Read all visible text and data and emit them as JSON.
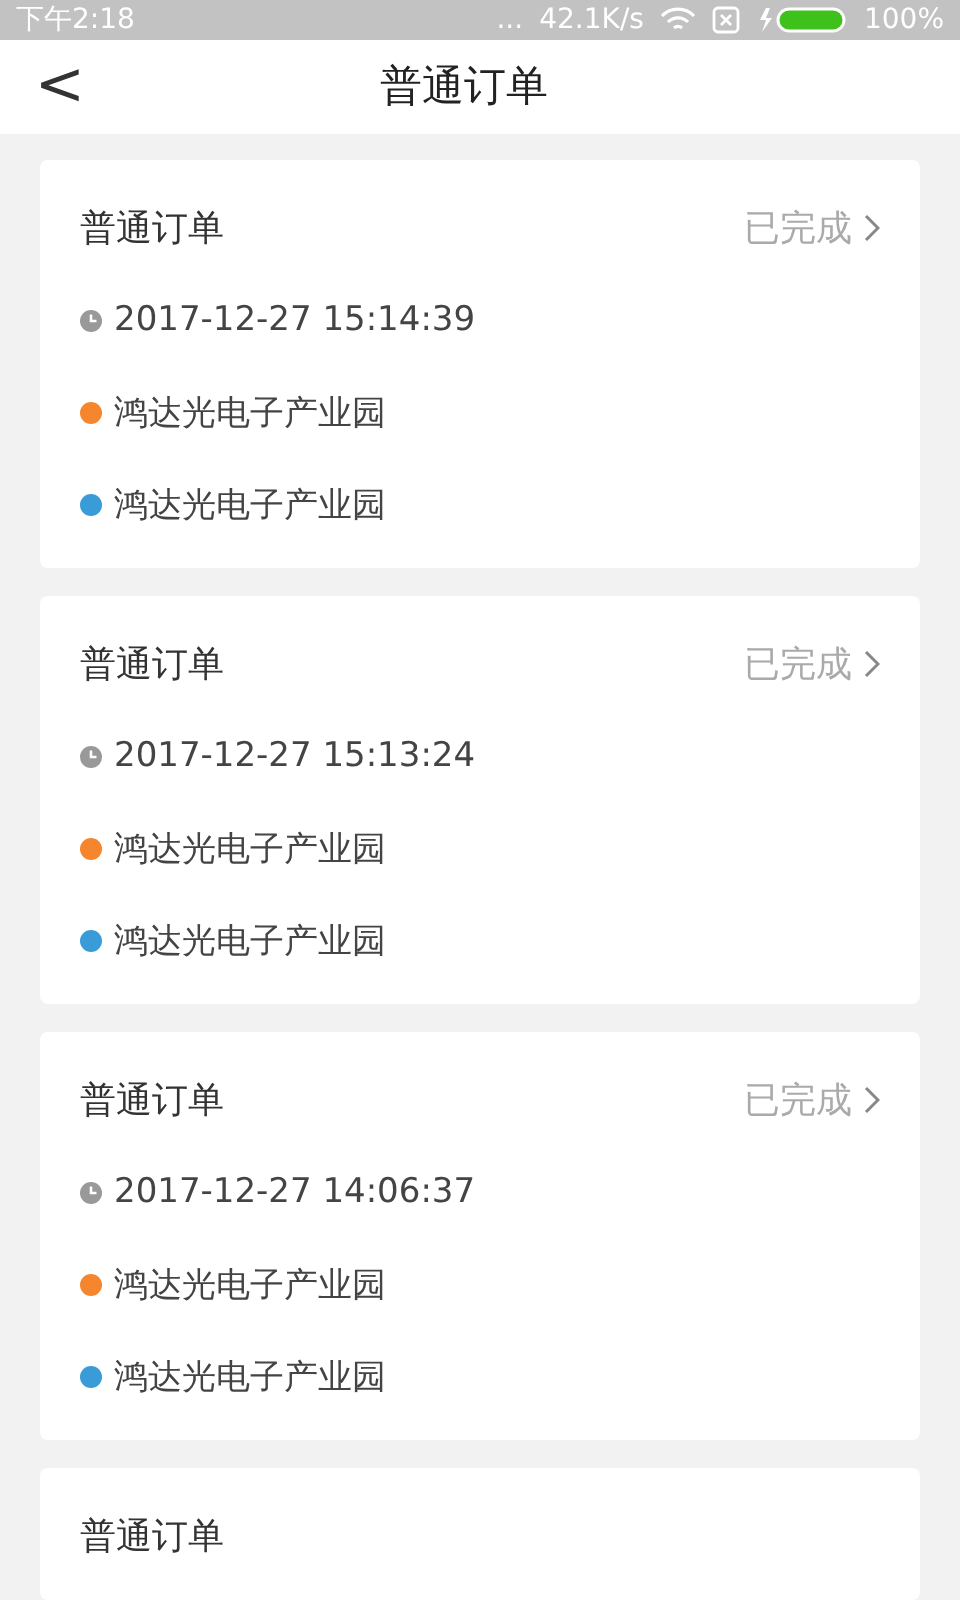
{
  "status_bar": {
    "time": "下午2:18",
    "dots": "...",
    "speed": "42.1K/s",
    "battery": "100%"
  },
  "header": {
    "back": "<",
    "title": "普通订单"
  },
  "orders": [
    {
      "title": "普通订单",
      "status": "已完成",
      "time": "2017-12-27 15:14:39",
      "stops": [
        {
          "name": "鸿达光电子产业园",
          "color": "#f5862e"
        },
        {
          "name": "鸿达光电子产业园",
          "color": "#3a9bd9"
        }
      ]
    },
    {
      "title": "普通订单",
      "status": "已完成",
      "time": "2017-12-27 15:13:24",
      "stops": [
        {
          "name": "鸿达光电子产业园",
          "color": "#f5862e"
        },
        {
          "name": "鸿达光电子产业园",
          "color": "#3a9bd9"
        }
      ]
    },
    {
      "title": "普通订单",
      "status": "已完成",
      "time": "2017-12-27 14:06:37",
      "stops": [
        {
          "name": "鸿达光电子产业园",
          "color": "#f5862e"
        },
        {
          "name": "鸿达光电子产业园",
          "color": "#3a9bd9"
        }
      ]
    },
    {
      "title": "普通订单"
    }
  ]
}
